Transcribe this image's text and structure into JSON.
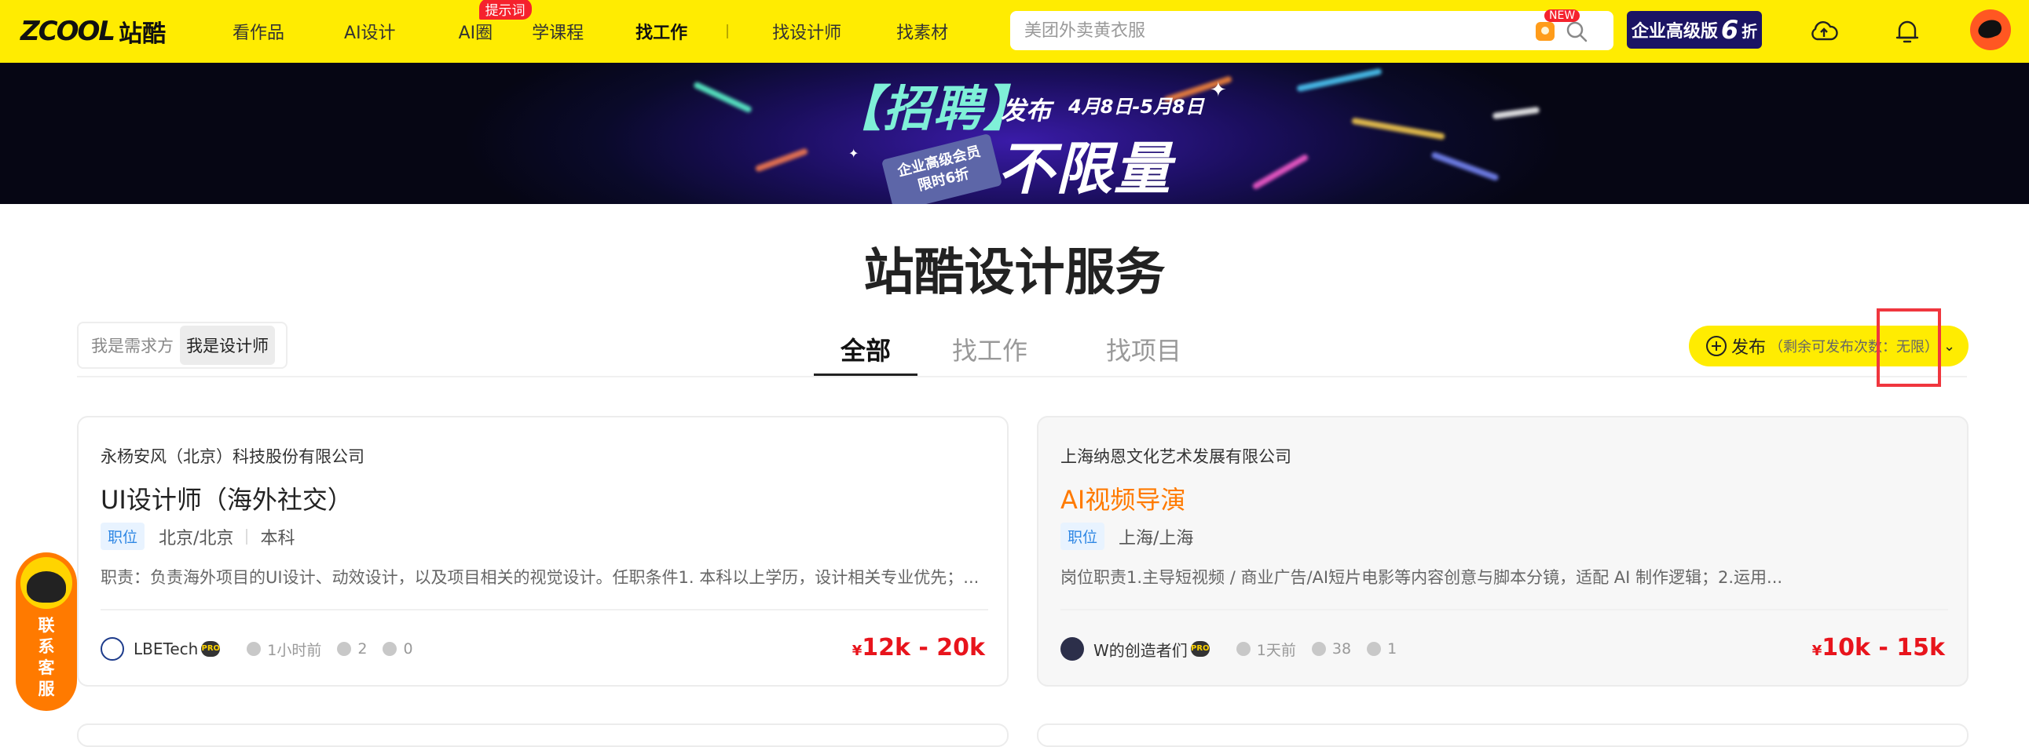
{
  "header": {
    "logo_word": "ZCOOL",
    "logo_cn": "站酷",
    "nav": [
      {
        "label": "看作品"
      },
      {
        "label": "AI设计"
      },
      {
        "label": "AI圈",
        "badge": "提示词"
      },
      {
        "label": "学课程"
      },
      {
        "label": "找工作"
      },
      {
        "label": "找设计师"
      },
      {
        "label": "找素材"
      }
    ],
    "search_placeholder": "美团外卖黄衣服",
    "search_new_badge": "NEW",
    "vip": {
      "label": "企业高级版",
      "number": "6",
      "suffix": "折"
    }
  },
  "banner": {
    "title": "【招聘】",
    "publish": "发布",
    "dates": "4月8日-5月8日",
    "unlimited": "不限量",
    "tag_line1": "企业高级会员",
    "tag_line2": "限时6折"
  },
  "page_title": "站酷设计服务",
  "role_toggle": {
    "options": [
      "我是需求方",
      "我是设计师"
    ],
    "active": "我是设计师"
  },
  "tabs": [
    {
      "label": "全部",
      "active": true
    },
    {
      "label": "找工作",
      "active": false
    },
    {
      "label": "找项目",
      "active": false
    }
  ],
  "publish": {
    "label": "发布",
    "remaining_prefix": "（剩余可发布次数：",
    "remaining_value": "无限",
    "remaining_suffix": "）"
  },
  "cards": [
    {
      "company": "永杨安风（北京）科技股份有限公司",
      "title": "UI设计师（海外社交）",
      "tag": "职位",
      "location": "北京/北京",
      "education": "本科",
      "description": "职责：负责海外项目的UI设计、动效设计，以及项目相关的视觉设计。任职条件1. 本科以上学历，设计相关专业优先；...",
      "user": "LBETech",
      "time": "1小时前",
      "views": "2",
      "likes": "0",
      "salary_symbol": "¥",
      "salary": "12k - 20k"
    },
    {
      "company": "上海纳恩文化艺术发展有限公司",
      "title": "AI视频导演",
      "tag": "职位",
      "location": "上海/上海",
      "description": "岗位职责1.主导短视频 / 商业广告/AI短片电影等内容创意与脚本分镜，适配 AI 制作逻辑；2.运用...",
      "user": "W的创造者们",
      "time": "1天前",
      "views": "38",
      "likes": "1",
      "salary_symbol": "¥",
      "salary": "10k - 15k"
    }
  ],
  "service": {
    "label": "联系客服"
  },
  "colors": {
    "brand_yellow": "#ffec01",
    "salary_red": "#e8141c",
    "accent_orange": "#ff7a00",
    "tag_blue": "#2f87e4"
  }
}
